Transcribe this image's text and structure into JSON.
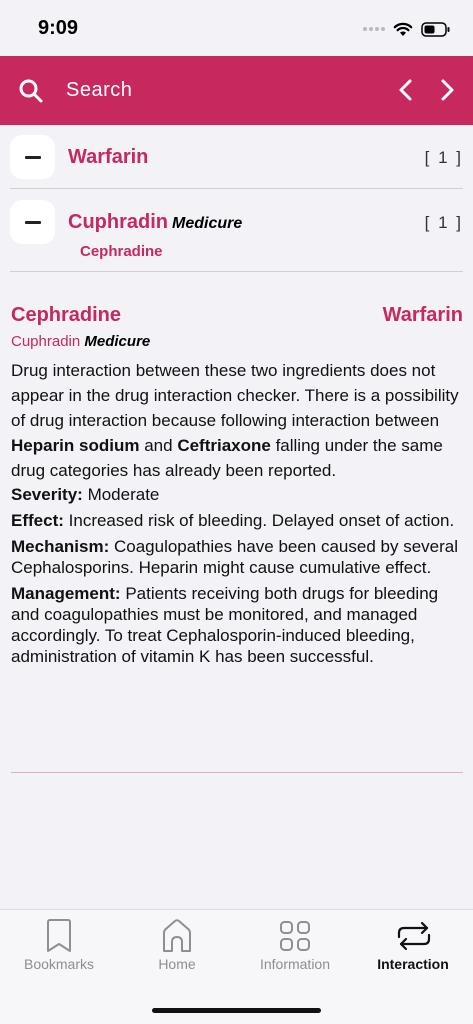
{
  "status_bar": {
    "time": "9:09"
  },
  "header": {
    "search_placeholder": "Search"
  },
  "ingredients": [
    {
      "name": "Warfarin",
      "count": "[ 1 ]"
    },
    {
      "name": "Cuphradin",
      "manufacturer": "Medicure",
      "count": "[ 1 ]",
      "generic": "Cephradine"
    }
  ],
  "detail": {
    "left_title": "Cephradine",
    "right_title": "Warfarin",
    "brand": "Cuphradin",
    "manufacturer": "Medicure",
    "intro_1": "Drug interaction between these two ingredients does not appear in the drug interaction checker. There is a possibility of drug interaction because following interaction between",
    "drug_a": "Heparin sodium",
    "intro_and": "and",
    "drug_b": "Ceftriaxone",
    "intro_2": "falling under the same drug categories has already been reported.",
    "severity_label": "Severity:",
    "severity": "Moderate",
    "effect_label": "Effect:",
    "effect": "Increased risk of bleeding. Delayed onset of action.",
    "mechanism_label": "Mechanism:",
    "mechanism": "Coagulopathies have been caused by several Cephalosporins. Heparin might cause cumulative effect.",
    "management_label": "Management:",
    "management": "Patients receiving both drugs for bleeding and coagulopathies must be monitored, and managed accordingly. To treat Cephalosporin-induced bleeding, administration of vitamin K has been successful."
  },
  "tabs": [
    {
      "label": "Bookmarks",
      "icon": "bookmark-icon"
    },
    {
      "label": "Home",
      "icon": "home-icon"
    },
    {
      "label": "Information",
      "icon": "grid-icon"
    },
    {
      "label": "Interaction",
      "icon": "repeat-icon",
      "active": true
    }
  ],
  "colors": {
    "accent": "#c7285e",
    "background": "#f2f2f7"
  }
}
